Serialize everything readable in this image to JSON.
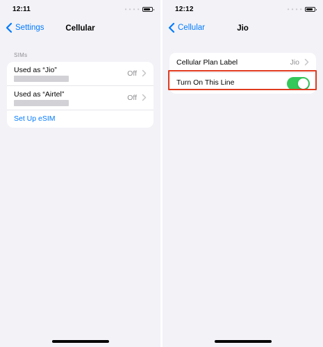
{
  "colors": {
    "accent": "#007aff",
    "toggle_on": "#34c759",
    "highlight": "#e03a1e",
    "background": "#f2f2f7"
  },
  "left_screen": {
    "status_time": "12:11",
    "back_label": "Settings",
    "title": "Cellular",
    "section_header": "SIMs",
    "sims": [
      {
        "label": "Used as “Jio”",
        "value": "Off"
      },
      {
        "label": "Used as “Airtel”",
        "value": "Off"
      }
    ],
    "setup_esim_label": "Set Up eSIM"
  },
  "right_screen": {
    "status_time": "12:12",
    "back_label": "Cellular",
    "title": "Jio",
    "plan_label_row": {
      "label": "Cellular Plan Label",
      "value": "Jio"
    },
    "line_toggle": {
      "label": "Turn On This Line",
      "on": true
    }
  }
}
